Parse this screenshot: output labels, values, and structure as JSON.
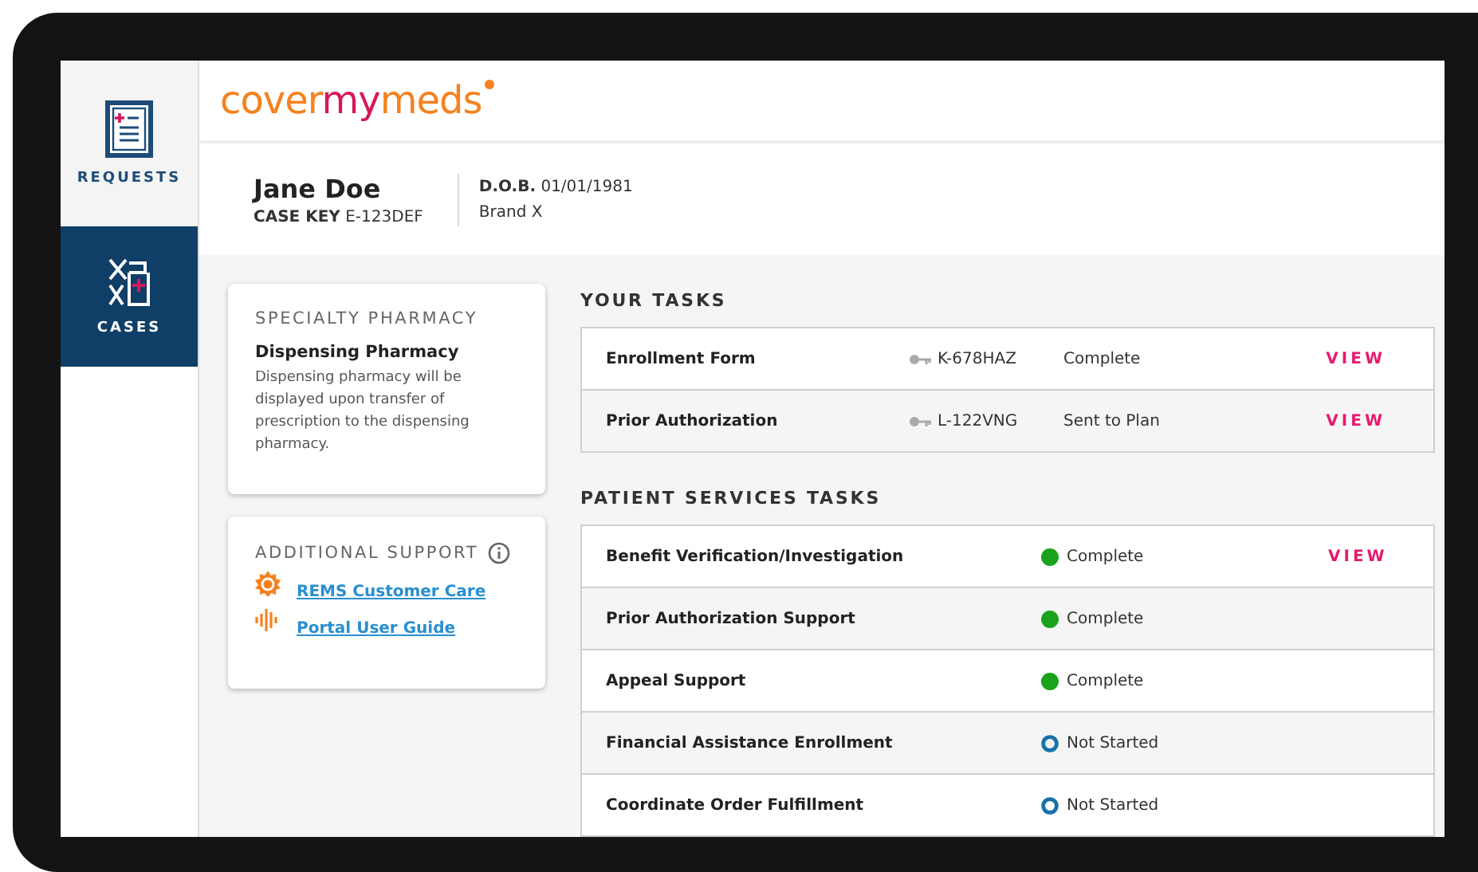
{
  "sidebar": {
    "items": [
      {
        "label": "REQUESTS",
        "kind": "requests",
        "selected": false
      },
      {
        "label": "CASES",
        "kind": "cases",
        "selected": true
      }
    ]
  },
  "logo": {
    "parts": [
      "cover",
      "my",
      "meds"
    ]
  },
  "patient": {
    "name": "Jane Doe",
    "case_key_label": "CASE KEY",
    "case_key": "E-123DEF",
    "dob_label": "D.O.B.",
    "dob": "01/01/1981",
    "brand": "Brand X"
  },
  "specialty_pharmacy": {
    "title": "SPECIALTY PHARMACY",
    "subtitle": "Dispensing Pharmacy",
    "text": "Dispensing pharmacy will be displayed upon transfer of prescription to the dispensing pharmacy."
  },
  "additional_support": {
    "title": "ADDITIONAL SUPPORT",
    "links": [
      {
        "label": "REMS Customer Care",
        "kind": "care"
      },
      {
        "label": "Portal User Guide",
        "kind": "guide"
      }
    ]
  },
  "your_tasks": {
    "title": "YOUR TASKS",
    "rows": [
      {
        "name": "Enrollment Form",
        "key": "K-678HAZ",
        "status": "Complete",
        "action": "VIEW"
      },
      {
        "name": "Prior Authorization",
        "key": "L-122VNG",
        "status": "Sent to Plan",
        "action": "VIEW"
      }
    ]
  },
  "patient_services_tasks": {
    "title": "PATIENT SERVICES TASKS",
    "rows": [
      {
        "name": "Benefit Verification/Investigation",
        "kind": "complete",
        "status": "Complete",
        "action": "VIEW"
      },
      {
        "name": "Prior Authorization Support",
        "kind": "complete",
        "status": "Complete"
      },
      {
        "name": "Appeal Support",
        "kind": "complete",
        "status": "Complete"
      },
      {
        "name": "Financial Assistance Enrollment",
        "kind": "not_started",
        "status": "Not Started"
      },
      {
        "name": "Coordinate Order Fulfillment",
        "kind": "not_started",
        "status": "Not Started"
      }
    ]
  }
}
